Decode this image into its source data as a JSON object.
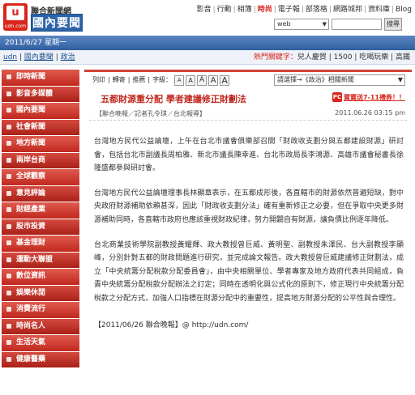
{
  "header": {
    "logo_text": "u",
    "logo_domain": "udn.com",
    "brand_top": "聯合新聞網",
    "brand_main": "國內要聞",
    "nav": [
      "影音",
      "行動",
      "相簿",
      "時尚",
      "電子報",
      "部落格",
      "網路城邦",
      "資料庫",
      "Blog"
    ],
    "nav_hot_index": 3,
    "search_scope": "web",
    "search_button": "搜尋"
  },
  "date_bar": {
    "text": "2011/6/27 星期一"
  },
  "breadcrumb": {
    "items": [
      "udn",
      "國內要聞",
      "政治"
    ],
    "ticker_red": "熱門關鍵字：",
    "ticker_rest": "兒人慶賀 | 1500 | 吃喝玩樂 | 高鐵"
  },
  "sidebar": {
    "items": [
      "即時新聞",
      "影音多媒體",
      "國內要聞",
      "社會新聞",
      "地方新聞",
      "兩岸台商",
      "全球觀察",
      "意見評論",
      "財經產業",
      "股市投資",
      "基金理財",
      "運動大聯盟",
      "數位資訊",
      "娛樂休閒",
      "消費流行",
      "時尚名人",
      "生活天氣",
      "健康醫藥"
    ]
  },
  "toolbar": {
    "items": [
      "列印",
      "轉寄",
      "推薦",
      "字級："
    ],
    "font_sizes": [
      "A",
      "A",
      "A",
      "A",
      "A"
    ],
    "select_label": "請選擇→《政治》相關新聞"
  },
  "article": {
    "title": "五都財源重分配 學者建議修正財劃法",
    "promo_icon": "PC",
    "promo_text": "寶寶送7-11禮券！！",
    "source": "【聯合晚報／記者孔令琪／台北報導】",
    "timestamp": "2011.06.26 03:15 pm",
    "paragraphs": [
      "台灣地方民代公益論壇，上午在台北市議會俱樂部召開「財政收支劃分與五都建設財源」研討會，包括台北市副議長周柏雅、新北市議長陳幸進、台北市政局長李鴻源、高雄市議會秘書長徐隆盛都參與研討會。",
      "台灣地方民代公益論壇理事長林顯章表示，在五都成形後，各直轄市的財源依然普遍短缺，對中央政府財源補助依賴甚深，因此「財政收支劃分法」確有重新修正之必要，但在爭取中央更多財源補助同時，各直轄市政府也應該重視財政紀律，努力開闢自有財源，讓負債比例逐年降低。",
      "台北商業技術學院副教授黃耀輝、政大教授曾巨威、黃明聖、副教授朱澤民、台大副教授李顯峰，分別針對五都的財政問題進行研究，並完成論文報告。政大教授曾巨威建議修正財劃法，成立「中央統籌分配稅款分配委員會」，由中央相關單位、學者專家及地方政府代表共同組成，負責中央統籌分配稅款分配辦法之訂定；同時在透明化與公式化的原則下，修正現行中央統籌分配稅款之分配方式，加強人口指標在財源分配中的重要性，提高地方財源分配的公平性與合理性。"
    ],
    "footer": "【2011/06/26 聯合晚報】@ http://udn.com/"
  }
}
